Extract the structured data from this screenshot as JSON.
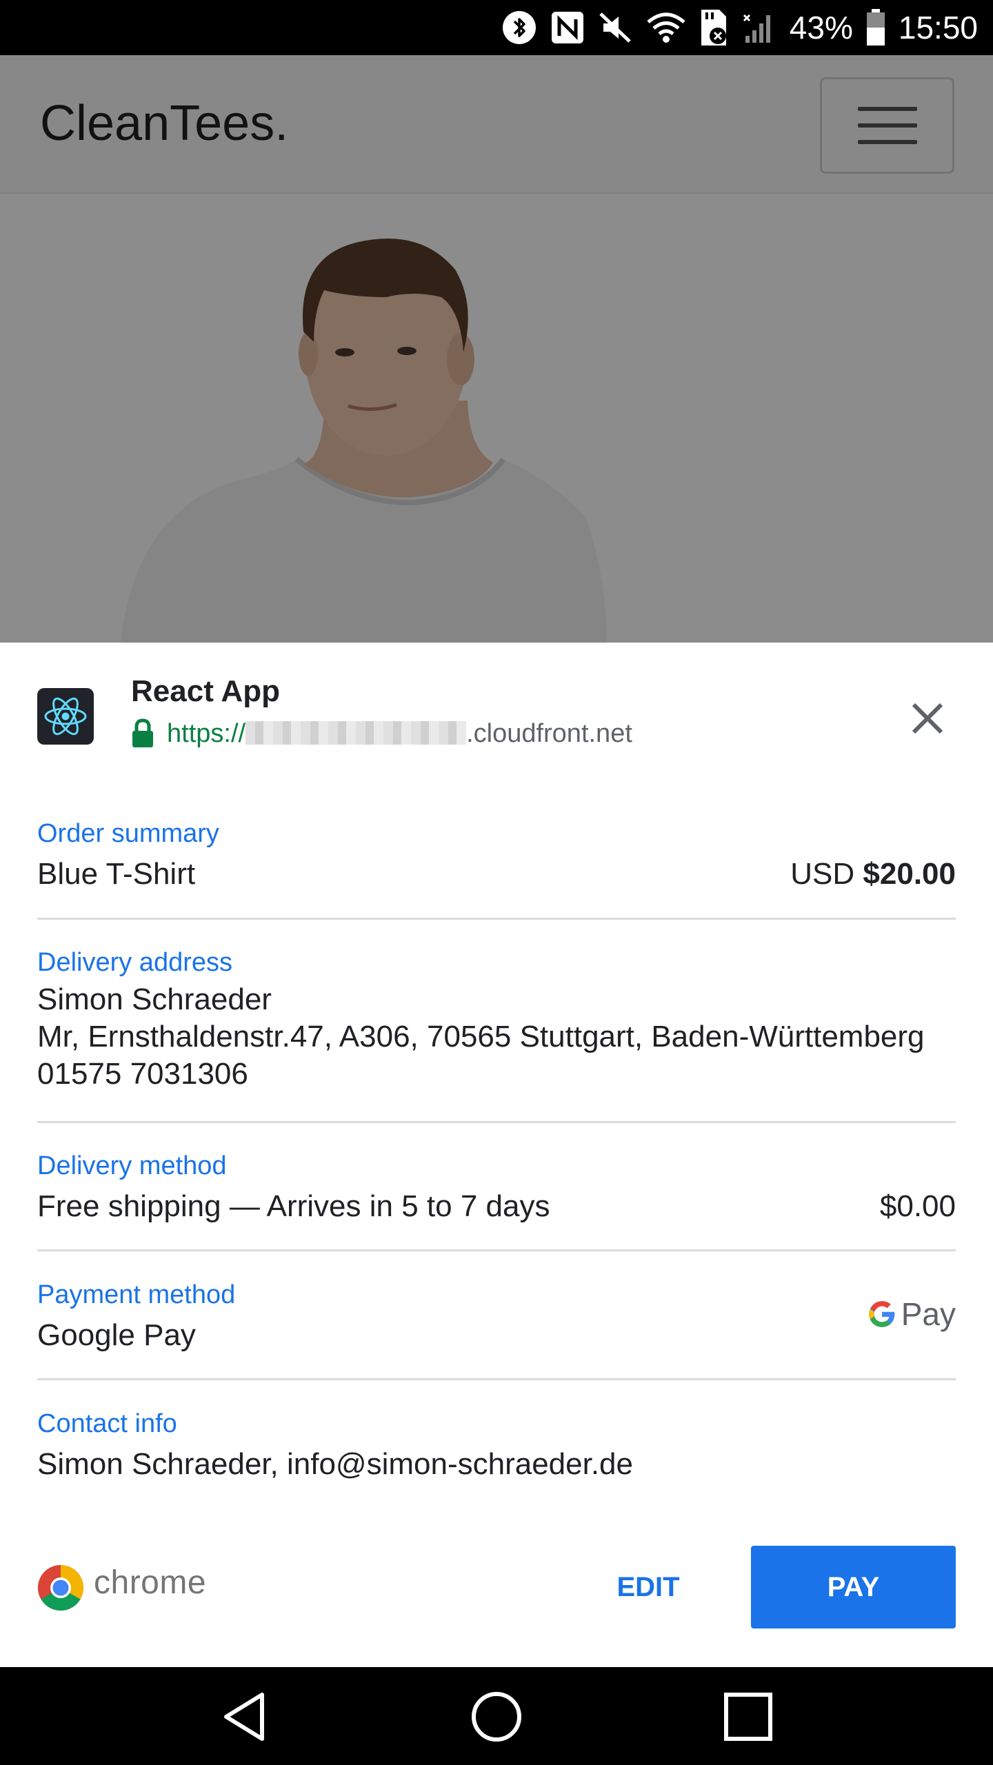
{
  "status_bar": {
    "battery_text": "43%",
    "time": "15:50",
    "icons": [
      "bluetooth-icon",
      "nfc-icon",
      "mute-icon",
      "wifi-icon",
      "sd-card-error-icon",
      "signal-icon",
      "battery-icon"
    ]
  },
  "website": {
    "brand": "CleanTees.",
    "menu_icon": "hamburger-menu-icon"
  },
  "payment_sheet": {
    "app_name": "React App",
    "url_scheme": "https://",
    "url_host": ".cloudfront.net",
    "close_icon": "close-icon",
    "order_summary": {
      "title": "Order summary",
      "item": "Blue T-Shirt",
      "currency": "USD",
      "amount": "$20.00"
    },
    "delivery_address": {
      "title": "Delivery address",
      "name": "Simon Schraeder",
      "address": "Mr, Ernsthaldenstr.47, A306, 70565 Stuttgart, Baden-Württemberg",
      "phone": "01575 7031306"
    },
    "delivery_method": {
      "title": "Delivery method",
      "option": "Free shipping — Arrives in 5 to 7 days",
      "price": "$0.00"
    },
    "payment_method": {
      "title": "Payment method",
      "value": "Google Pay",
      "logo_text": "Pay"
    },
    "contact_info": {
      "title": "Contact info",
      "value": "Simon Schraeder, info@simon-schraeder.de"
    },
    "footer": {
      "brand": "chrome",
      "edit_label": "EDIT",
      "pay_label": "PAY"
    }
  },
  "nav_bar": {
    "icons": [
      "back-icon",
      "home-icon",
      "recents-icon"
    ]
  },
  "colors": {
    "accent": "#1a73e8",
    "secure_green": "#0b8043",
    "react_cyan": "#61dafb"
  }
}
